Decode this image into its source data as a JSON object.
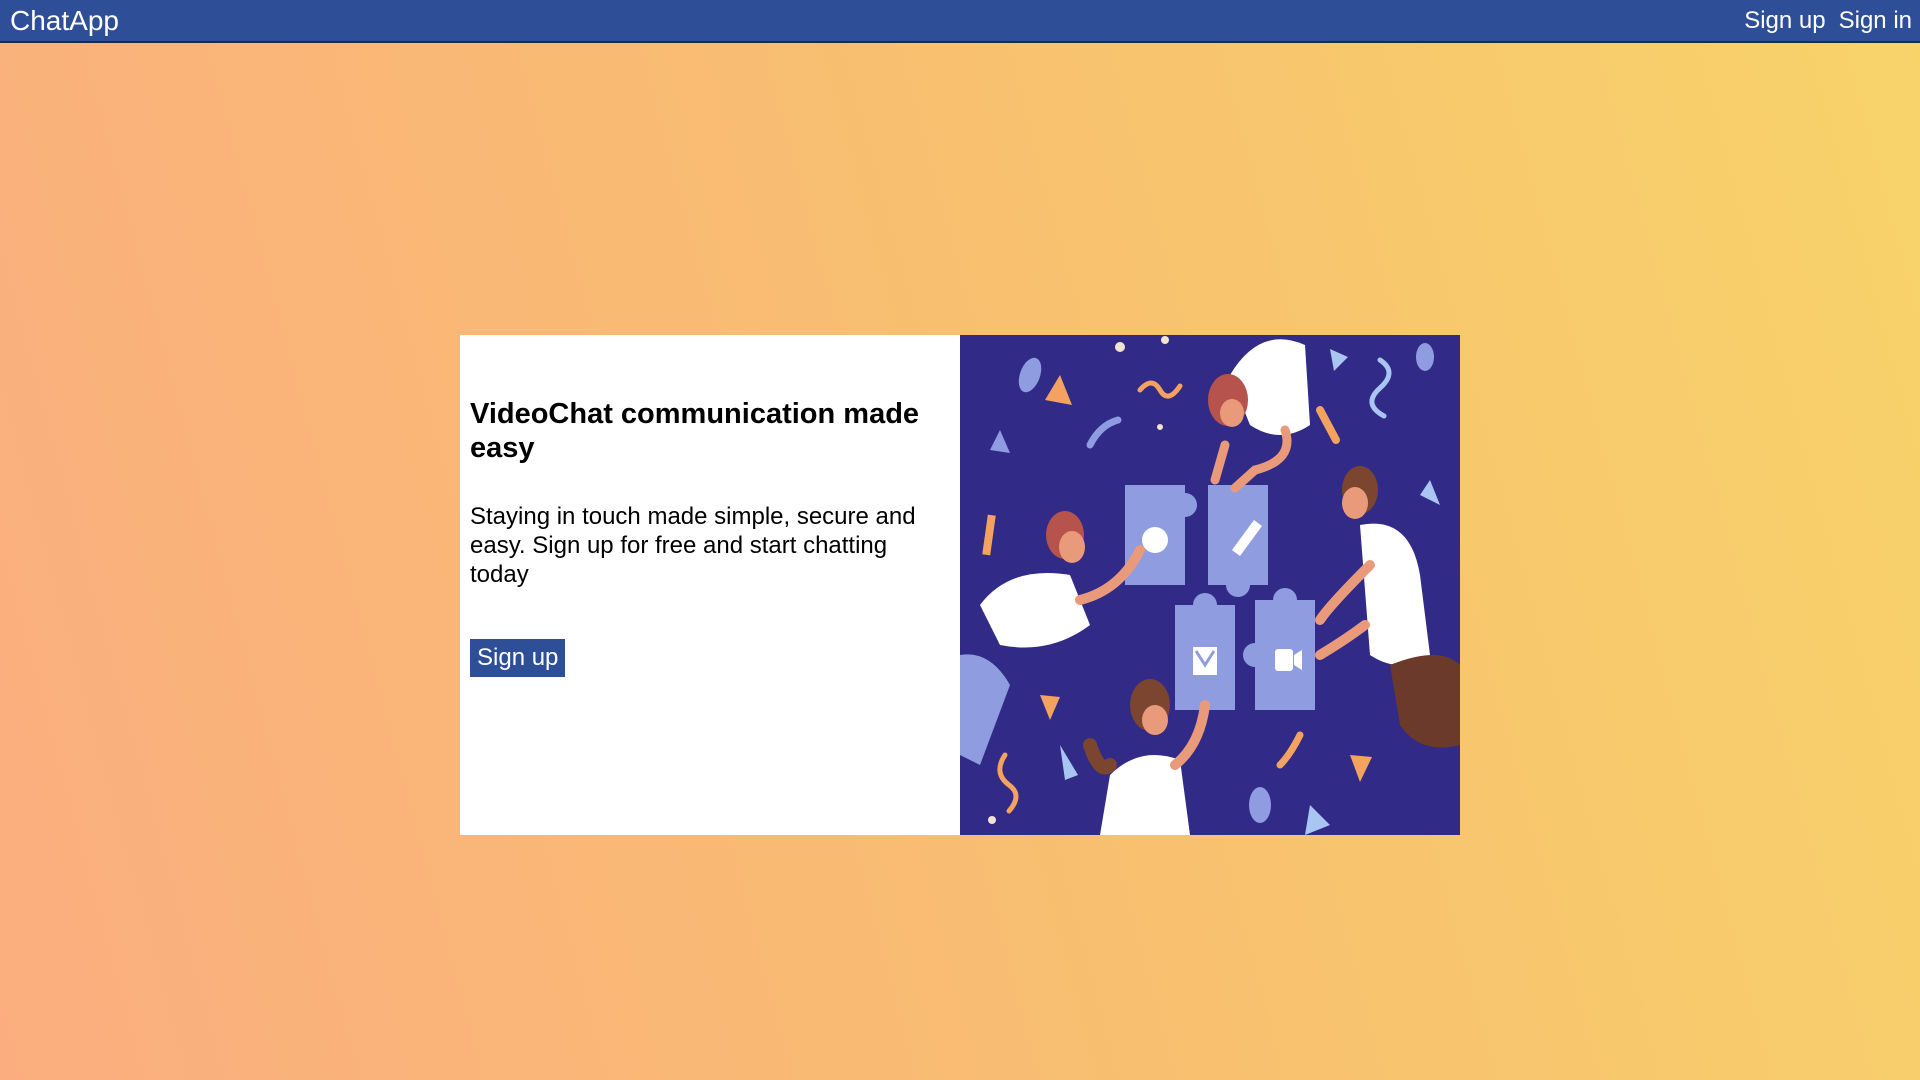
{
  "navbar": {
    "brand": "ChatApp",
    "links": [
      {
        "label": "Sign up"
      },
      {
        "label": "Sign in"
      }
    ],
    "color": "#2e4f97"
  },
  "hero": {
    "title": "VideoChat communication made easy",
    "description": "Staying in touch made simple, secure and easy. Sign up for free and start chatting today",
    "cta_label": "Sign up",
    "illustration": {
      "icon": "puzzle-people-illustration",
      "background": "#312a87"
    }
  },
  "colors": {
    "accent": "#2e4f97",
    "background_start": "#fbad7f",
    "background_end": "#f8d36a"
  }
}
